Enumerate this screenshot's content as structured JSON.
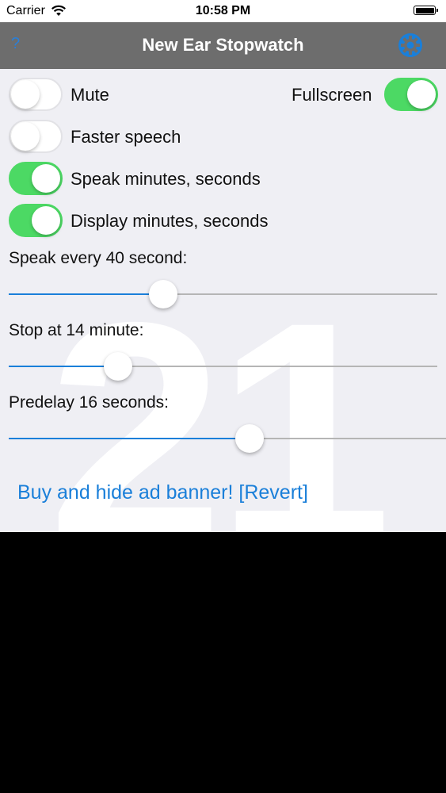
{
  "status_bar": {
    "carrier": "Carrier",
    "time": "10:58 PM",
    "battery_level": 1.0
  },
  "nav": {
    "help_label": "?",
    "title": "New Ear Stopwatch",
    "settings_icon": "gear-icon"
  },
  "background_number": "21",
  "toggles": {
    "mute": {
      "label": "Mute",
      "on": false
    },
    "fullscreen": {
      "label": "Fullscreen",
      "on": true
    },
    "faster_speech": {
      "label": "Faster speech",
      "on": false
    },
    "speak_minutes": {
      "label": "Speak minutes, seconds",
      "on": true
    },
    "display_minutes": {
      "label": "Display minutes, seconds",
      "on": true
    }
  },
  "sliders": {
    "speak_every": {
      "label": "Speak every 40 second:",
      "fraction": 0.36
    },
    "stop_at": {
      "label": "Stop at 14 minute:",
      "fraction": 0.255
    },
    "predelay": {
      "label": "Predelay 16 seconds:",
      "fraction": 0.55
    }
  },
  "buy_link": "Buy and hide ad banner! [Revert]",
  "colors": {
    "accent": "#1a7fd9",
    "toggle_on": "#4cd964",
    "nav_bg": "#6d6d6d",
    "panel_bg": "#efeff4"
  }
}
